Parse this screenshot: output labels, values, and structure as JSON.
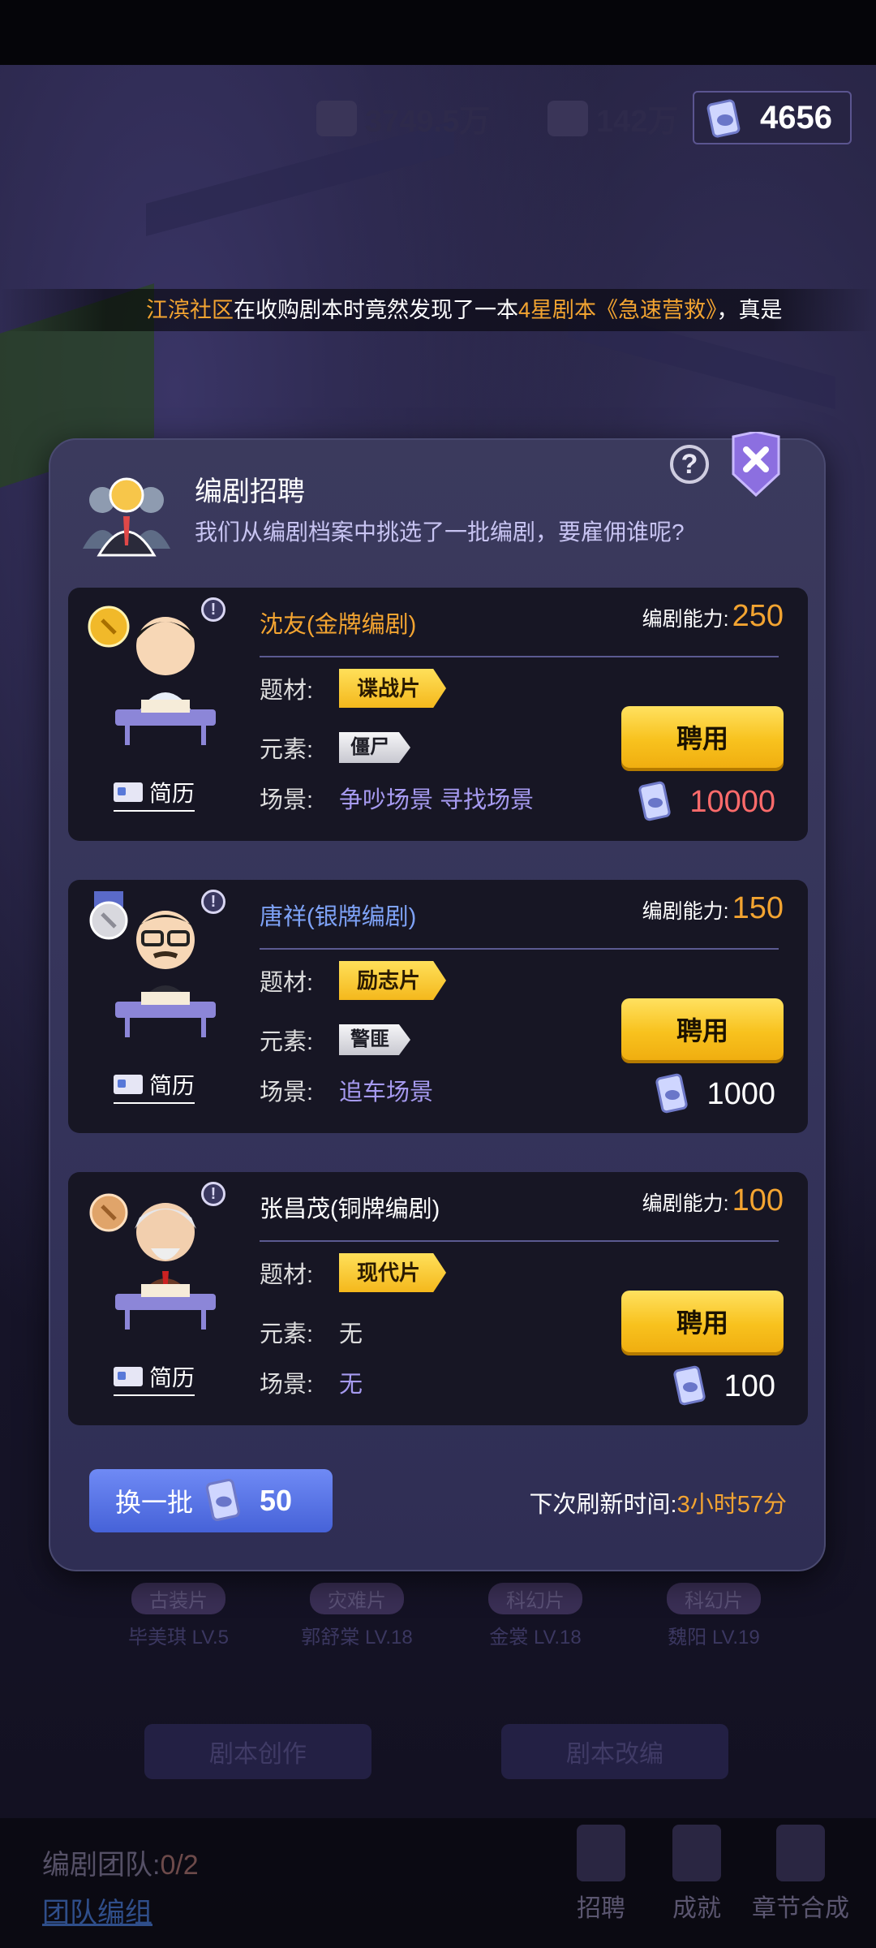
{
  "resources": {
    "money": "3749.5万",
    "fans": "142万",
    "gems": "4656"
  },
  "ticker": {
    "community": "江滨社区",
    "text1": "在收购剧本时竟然发现了一本",
    "highlight": "4星剧本《急速营救》",
    "text2": "，真是"
  },
  "dialog": {
    "title": "编剧招聘",
    "subtitle": "我们从编剧档案中挑选了一批编剧，要雇佣谁呢?",
    "help_label": "?",
    "labels": {
      "genre": "题材:",
      "element": "元素:",
      "scene": "场景:",
      "ability": "编剧能力:",
      "resume": "简历",
      "hire": "聘用"
    },
    "candidates": [
      {
        "name": "沈友(金牌编剧)",
        "name_color": "#f3a431",
        "ability": "250",
        "genre": "谍战片",
        "element": "僵尸",
        "scene": "争吵场景 寻找场景",
        "cost": "10000",
        "cost_color": "#ff6b6b"
      },
      {
        "name": "唐祥(银牌编剧)",
        "name_color": "#7ea2f6",
        "ability": "150",
        "genre": "励志片",
        "element": "警匪",
        "scene": "追车场景",
        "cost": "1000",
        "cost_color": "#ffffff"
      },
      {
        "name": "张昌茂(铜牌编剧)",
        "name_color": "#ffffff",
        "ability": "100",
        "genre": "现代片",
        "element": "无",
        "scene": "无",
        "cost": "100",
        "cost_color": "#ffffff"
      }
    ],
    "swap_label": "换一批",
    "swap_cost": "50",
    "refresh_label": "下次刷新时间:",
    "refresh_time": "3小时57分"
  },
  "background": {
    "cards": [
      {
        "tag": "古装片",
        "name": "毕美琪",
        "level": "LV.5"
      },
      {
        "tag": "灾难片",
        "name": "郭舒棠",
        "level": "LV.18"
      },
      {
        "tag": "科幻片",
        "name": "金裳",
        "level": "LV.18"
      },
      {
        "tag": "科幻片",
        "name": "魏阳",
        "level": "LV.19"
      }
    ],
    "btn_create": "剧本创作",
    "btn_adapt": "剧本改编",
    "team_label": "编剧团队:",
    "team_count": "0/2",
    "team_link": "团队编组",
    "nav": [
      "招聘",
      "成就",
      "章节合成"
    ]
  }
}
